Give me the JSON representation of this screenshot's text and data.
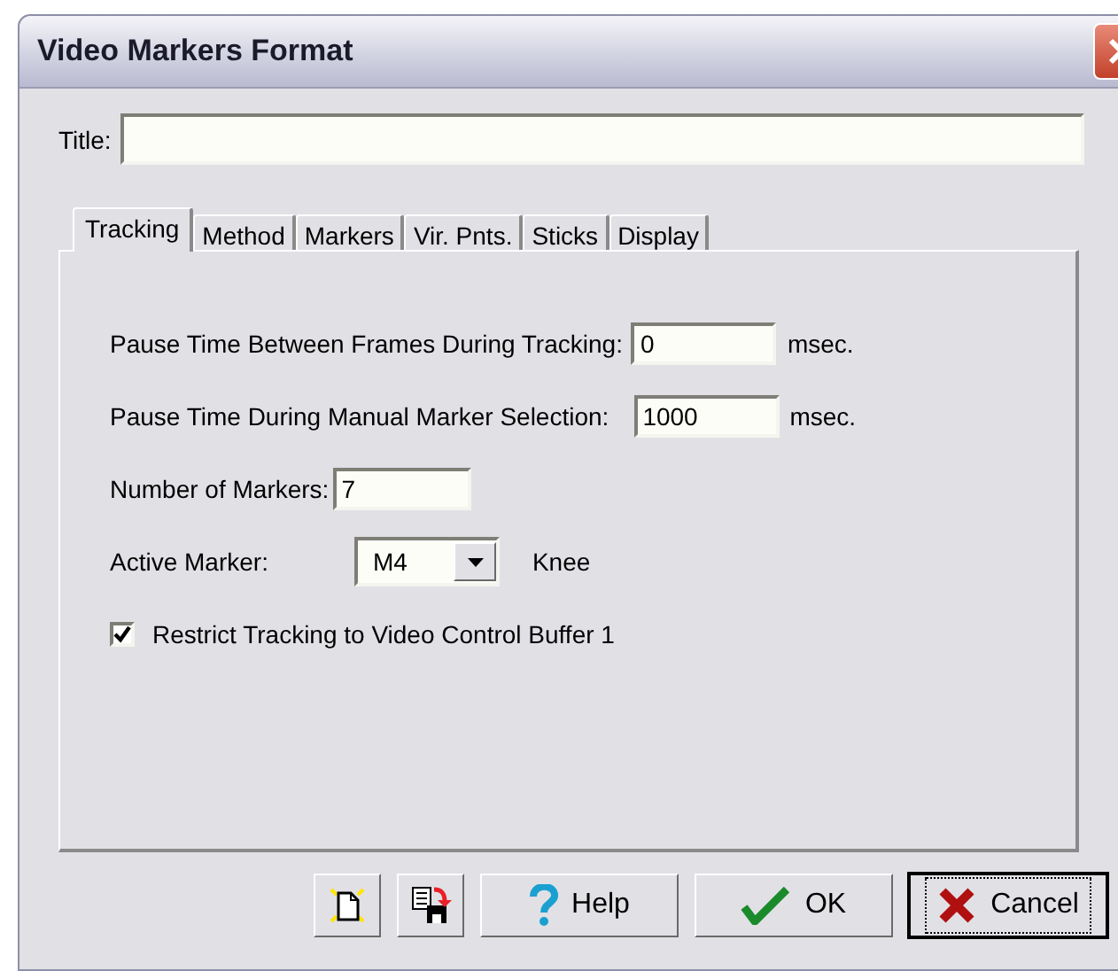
{
  "window": {
    "title": "Video Markers Format"
  },
  "title_field": {
    "label": "Title:"
  },
  "tabs": [
    {
      "label": "Tracking",
      "selected": true
    },
    {
      "label": "Method",
      "selected": false
    },
    {
      "label": "Markers",
      "selected": false
    },
    {
      "label": "Vir. Pnts.",
      "selected": false
    },
    {
      "label": "Sticks",
      "selected": false
    },
    {
      "label": "Display",
      "selected": false
    }
  ],
  "pause_tracking": {
    "label": "Pause Time Between Frames During Tracking:",
    "value": "0",
    "unit": "msec."
  },
  "pause_manual": {
    "label": "Pause Time During Manual Marker Selection:",
    "value": "1000",
    "unit": "msec."
  },
  "number_of_markers": {
    "label": "Number of Markers:",
    "value": "7"
  },
  "active_marker": {
    "label": "Active Marker:",
    "value": "M4",
    "name": "Knee"
  },
  "restrict": {
    "label": "Restrict Tracking to Video Control Buffer 1",
    "checked": true
  },
  "buttons": [
    {
      "kind": "new"
    },
    {
      "kind": "save"
    },
    {
      "kind": "help",
      "label": "Help",
      "default": false
    },
    {
      "kind": "ok",
      "label": "OK",
      "default": false
    },
    {
      "kind": "cancel",
      "label": "Cancel",
      "default": true
    }
  ]
}
